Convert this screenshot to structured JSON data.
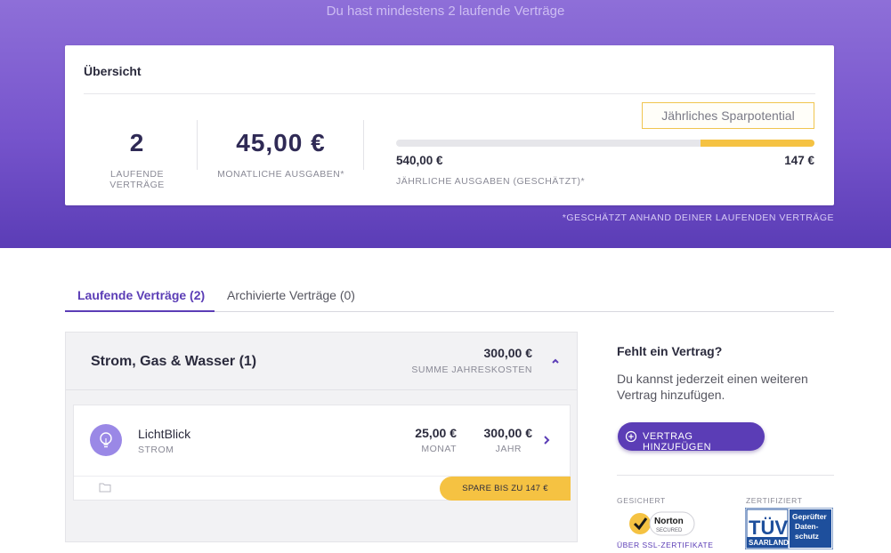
{
  "hero": {
    "subtitle": "Du hast mindestens 2 laufende Verträge",
    "color": "#7654cc"
  },
  "overview": {
    "title": "Übersicht",
    "running_count": "2",
    "running_label": "LAUFENDE VERTRÄGE",
    "monthly_value": "45,00 €",
    "monthly_label": "MONATLICHE AUSGABEN*",
    "savings_badge": "Jährliches Sparpotential",
    "annual_value": "540,00 €",
    "savings_value": "147 €",
    "annual_label": "JÄHRLICHE AUSGABEN (GESCHÄTZT)*",
    "savings_fraction": 0.272,
    "savings_color": "#f5c242"
  },
  "footnote": "*GESCHÄTZT ANHAND DEINER LAUFENDEN VERTRÄGE",
  "tabs": [
    {
      "label": "Laufende Verträge (2)",
      "active": true
    },
    {
      "label": "Archivierte Verträge (0)",
      "active": false
    }
  ],
  "group": {
    "title": "Strom, Gas & Wasser (1)",
    "sum_value": "300,00 €",
    "sum_label": "SUMME JAHRESKOSTEN",
    "expand_icon": "chevron-up-icon",
    "contract": {
      "name": "LichtBlick",
      "type": "STROM",
      "icon": "lightbulb-icon",
      "monthly": "25,00 €",
      "monthly_label": "MONAT",
      "yearly": "300,00 €",
      "yearly_label": "JAHR",
      "spare": "SPARE BIS ZU 147 €"
    }
  },
  "sidebar": {
    "title": "Fehlt ein Vertrag?",
    "text": "Du kannst jederzeit einen weiteren Vertrag hinzufügen.",
    "add_button": "VERTRAG HINZUFÜGEN",
    "secured_label": "GESICHERT",
    "norton_text": "Norton",
    "norton_sub": "SECURED",
    "ssl_link": "ÜBER SSL-ZERTIFIKATE",
    "certified_label": "ZERTIFIZIERT",
    "tuev_text": "TÜV",
    "tuev_region": "SAARLAND",
    "tuev_right": "Geprüfter Daten-schutz",
    "accent": "#5b3db6"
  }
}
